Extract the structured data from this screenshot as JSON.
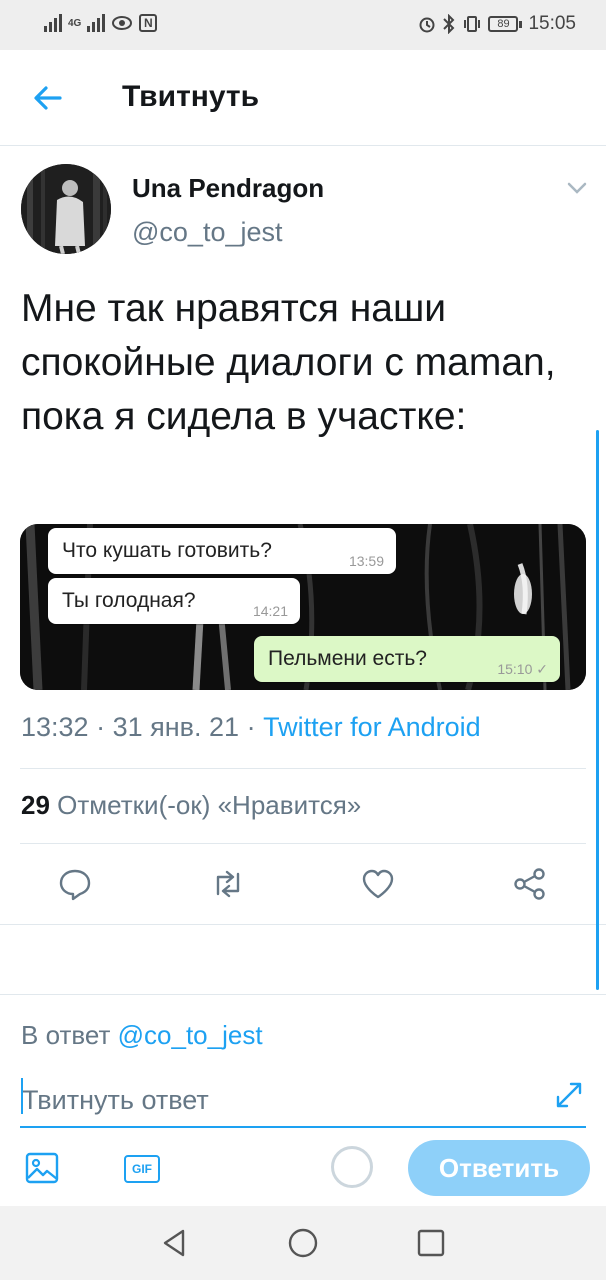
{
  "status_bar": {
    "network": "4G",
    "nfc": "N",
    "battery": "89",
    "time": "15:05"
  },
  "header": {
    "title": "Твитнуть",
    "back_icon": "arrow-left-icon"
  },
  "tweet": {
    "display_name": "Una Pendragon",
    "handle": "@co_to_jest",
    "text": "Мне так нравятся наши спокойные диалоги с maman, пока я сидела в участке:",
    "media": {
      "messages": [
        {
          "text": "Что кушать готовить?",
          "time": "13:59",
          "direction": "incoming"
        },
        {
          "text": "Ты голодная?",
          "time": "14:21",
          "direction": "incoming"
        },
        {
          "text": "Пельмени есть?",
          "time": "15:10 ✓",
          "direction": "outgoing"
        }
      ]
    },
    "time": "13:32",
    "date": "31 янв. 21",
    "separator": "·",
    "source": "Twitter for Android",
    "likes_count": "29",
    "likes_label": "Отметки(-ок) «Нравится»",
    "actions": [
      "reply-icon",
      "retweet-icon",
      "like-icon",
      "share-icon"
    ]
  },
  "reply": {
    "reply_to_prefix": "В ответ",
    "reply_to_user": "@co_to_jest",
    "placeholder": "Твитнуть ответ",
    "submit_label": "Ответить",
    "tools": [
      "image-icon",
      "gif-icon"
    ],
    "gif_label": "GIF"
  },
  "colors": {
    "accent": "#1da1f2",
    "accent_disabled": "#8ed0f9",
    "secondary_text": "#657786",
    "divider": "#e1e8ed",
    "incoming_bubble": "#ffffff",
    "outgoing_bubble": "#dcf8c6"
  }
}
